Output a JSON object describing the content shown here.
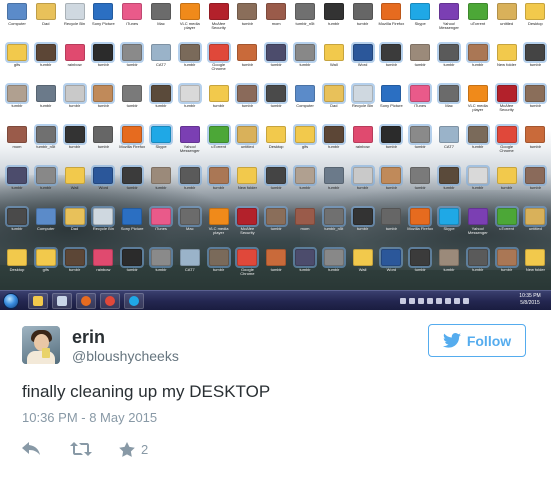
{
  "desktop": {
    "taskbar_clock": {
      "time": "10:35 PM",
      "date": "5/8/2015"
    },
    "icons": [
      {
        "label": "Computer",
        "color": "#5b8bc9"
      },
      {
        "label": "Dad",
        "color": "#e8c15a"
      },
      {
        "label": "Recycle Bin",
        "color": "#cfd8e0"
      },
      {
        "label": "Sony Picture",
        "color": "#2b6fc2"
      },
      {
        "label": "iTunes",
        "color": "#e95a8a"
      },
      {
        "label": "Mac",
        "color": "#6b6b6b"
      },
      {
        "label": "VLC media player",
        "color": "#f08a1a"
      },
      {
        "label": "McAfee Security",
        "color": "#b3212b"
      },
      {
        "label": "tumblr",
        "color": "#8a6e5a"
      },
      {
        "label": "mom",
        "color": "#9a5b4a"
      },
      {
        "label": "tumblr_n5t",
        "color": "#707070"
      },
      {
        "label": "tumblr",
        "color": "#333333"
      },
      {
        "label": "tumblr",
        "color": "#666666"
      },
      {
        "label": "Mozilla Firefox",
        "color": "#e66b1f"
      },
      {
        "label": "Skype",
        "color": "#1fa8e6"
      },
      {
        "label": "Yahoo! Messenger",
        "color": "#7b3fb3"
      },
      {
        "label": "uTorrent",
        "color": "#4ca737"
      },
      {
        "label": "untitled",
        "color": "#d9b15a"
      },
      {
        "label": "Desktop",
        "color": "#f2c94c"
      },
      {
        "label": "gifs",
        "color": "#f2c94c"
      },
      {
        "label": "tumblr",
        "color": "#5c4636"
      },
      {
        "label": "rainbow",
        "color": "#e04a6f"
      },
      {
        "label": "tumblr",
        "color": "#2b2b2b"
      },
      {
        "label": "tumblr",
        "color": "#8a8a8a"
      },
      {
        "label": "CAT7",
        "color": "#9ab3c9"
      },
      {
        "label": "tumblr",
        "color": "#7a6a5a"
      },
      {
        "label": "Google Chrome",
        "color": "#e0483a"
      },
      {
        "label": "tumblr",
        "color": "#c96a3a"
      },
      {
        "label": "tumblr",
        "color": "#4c4c6c"
      },
      {
        "label": "tumblr",
        "color": "#888888"
      },
      {
        "label": "Wall",
        "color": "#f2c94c"
      },
      {
        "label": "Word",
        "color": "#2b579a"
      },
      {
        "label": "tumblr",
        "color": "#3b3b3b"
      },
      {
        "label": "tumblr",
        "color": "#9b8a7a"
      },
      {
        "label": "tumblr",
        "color": "#5a5a5a"
      },
      {
        "label": "tumblr",
        "color": "#aa7755"
      },
      {
        "label": "New folder",
        "color": "#f2c94c"
      },
      {
        "label": "tumblr",
        "color": "#444444"
      },
      {
        "label": "tumblr",
        "color": "#b0a090"
      },
      {
        "label": "tumblr",
        "color": "#6b7a8a"
      },
      {
        "label": "tumblr",
        "color": "#c9c9c9"
      },
      {
        "label": "tumblr",
        "color": "#c08a5a"
      },
      {
        "label": "tumblr",
        "color": "#7a7a7a"
      },
      {
        "label": "tumblr",
        "color": "#5a4a3a"
      },
      {
        "label": "tumblr",
        "color": "#d9d9d9"
      },
      {
        "label": "tumblr",
        "color": "#f2c94c"
      },
      {
        "label": "tumblr",
        "color": "#8a6a5a"
      },
      {
        "label": "tumblr",
        "color": "#4a4a4a"
      }
    ]
  },
  "tweet": {
    "name": "erin",
    "handle": "@bloushycheeks",
    "follow_label": "Follow",
    "text": "finally cleaning up my DESKTOP",
    "timestamp": "10:36 PM - 8 May 2015",
    "favorite_count": "2",
    "colors": {
      "twitter_blue": "#55acee",
      "text": "#292f33",
      "muted": "#8899a6"
    }
  }
}
